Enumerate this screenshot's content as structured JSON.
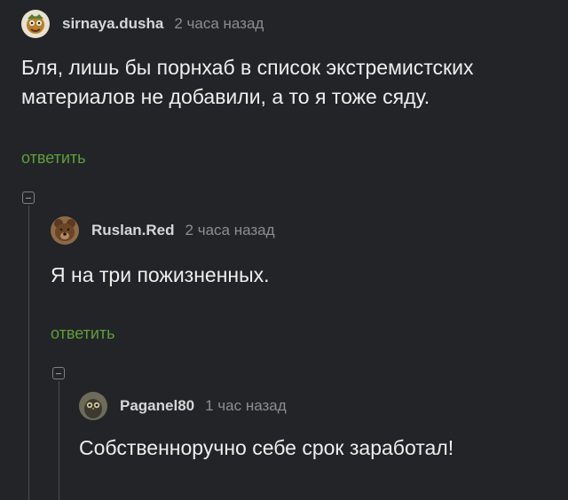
{
  "comments": [
    {
      "author": "sirnaya.dusha",
      "time": "2 часа назад",
      "text": "Бля, лишь бы порнхаб в список экстремистских материалов не добавили, а то я тоже сяду.",
      "reply_label": "ответить",
      "avatar_icon": "character-avatar-icon"
    },
    {
      "author": "Ruslan.Red",
      "time": "2 часа назад",
      "text": "Я на три пожизненных.",
      "reply_label": "ответить",
      "avatar_icon": "bear-avatar-icon"
    },
    {
      "author": "Paganel80",
      "time": "1 час назад",
      "text": "Собственноручно себе срок заработал!",
      "avatar_icon": "owl-avatar-icon"
    }
  ],
  "colors": {
    "background": "#232427",
    "reply_link": "#5f9e3c",
    "username": "#d6d6d6",
    "timestamp": "#8d8d8d",
    "text": "#eeeeee"
  }
}
